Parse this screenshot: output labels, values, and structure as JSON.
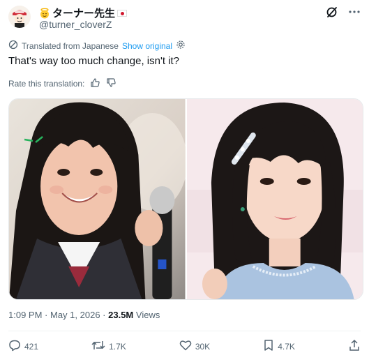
{
  "author": {
    "display_name": "ターナー先生",
    "handle": "@turner_cloverZ"
  },
  "translation": {
    "label": "Translated from Japanese",
    "show_original": "Show original"
  },
  "tweet": {
    "text": "That's way too much change, isn't it?"
  },
  "rate": {
    "label": "Rate this translation:"
  },
  "meta": {
    "time": "1:09 PM",
    "date": "May 1, 2026",
    "views_count": "23.5M",
    "views_label": "Views"
  },
  "actions": {
    "replies": "421",
    "reposts": "1.7K",
    "likes": "30K",
    "bookmarks": "4.7K"
  },
  "colors": {
    "link": "#1d9bf0",
    "muted": "#536471",
    "text": "#0f1419"
  }
}
